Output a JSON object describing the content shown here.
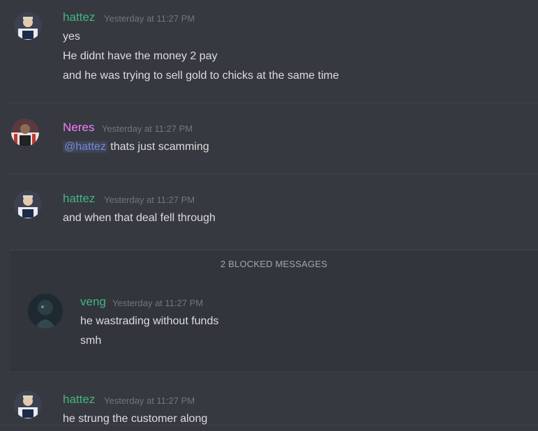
{
  "messages": [
    {
      "author": "hattez",
      "author_color": "#43b581",
      "timestamp": "Yesterday at 11:27 PM",
      "lines": [
        "yes",
        "He didnt have the money 2 pay",
        "and he was trying to sell gold to chicks at the same time"
      ]
    },
    {
      "author": "Neres",
      "author_color": "#f47fff",
      "timestamp": "Yesterday at 11:27 PM",
      "mention": "@hattez",
      "lines": [
        " thats just scamming"
      ]
    },
    {
      "author": "hattez",
      "author_color": "#43b581",
      "timestamp": "Yesterday at 11:27 PM",
      "lines": [
        "and when that deal fell through"
      ]
    },
    {
      "author": "veng",
      "author_color": "#43b581",
      "timestamp": "Yesterday at 11:27 PM",
      "lines": [
        "he wastrading without funds",
        "smh"
      ]
    },
    {
      "author": "hattez",
      "author_color": "#43b581",
      "timestamp": "Yesterday at 11:27 PM",
      "lines": [
        "he strung the customer along"
      ]
    }
  ],
  "blocked": {
    "label": "2 BLOCKED MESSAGES"
  },
  "icons": {
    "avatar_hattez": "avatar-hattez-icon",
    "avatar_neres": "avatar-neres-icon",
    "avatar_veng": "avatar-veng-icon"
  },
  "colors": {
    "background": "#36393f",
    "blocked_bg": "#32353b",
    "timestamp": "#72767d",
    "mention": "#7289da"
  }
}
